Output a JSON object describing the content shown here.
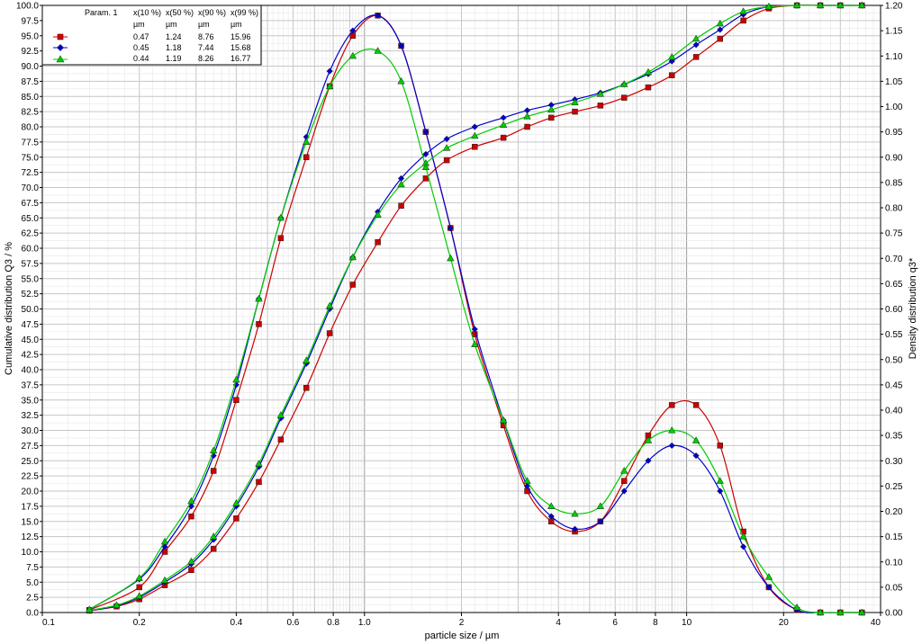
{
  "chart_data": {
    "type": "line",
    "xlabel": "particle size / µm",
    "ylabel_left": "Cumulative distribution Q3 / %",
    "ylabel_right": "Density distribution q3*",
    "x_scale": "log",
    "xlim": [
      0.1,
      40
    ],
    "ylim_left": [
      0,
      100
    ],
    "ylim_right": [
      0,
      1.2
    ],
    "x_tick_labels": [
      "0.1",
      "0.2",
      "0.4",
      "0.6",
      "0.8",
      "1.0",
      "2",
      "4",
      "6",
      "8",
      "10",
      "20",
      "40"
    ],
    "y_left_tick_labels": [
      "0.0",
      "2.5",
      "5.0",
      "7.5",
      "10.0",
      "12.5",
      "15.0",
      "17.5",
      "20.0",
      "22.5",
      "25.0",
      "27.5",
      "30.0",
      "32.5",
      "35.0",
      "37.5",
      "40.0",
      "42.5",
      "45.0",
      "47.5",
      "50.0",
      "52.5",
      "55.0",
      "57.5",
      "60.0",
      "62.5",
      "65.0",
      "67.5",
      "70.0",
      "72.5",
      "75.0",
      "77.5",
      "80.0",
      "82.5",
      "85.0",
      "87.5",
      "90.0",
      "92.5",
      "95.0",
      "97.5",
      "100.0"
    ],
    "y_right_tick_labels": [
      "0.00",
      "0.05",
      "0.10",
      "0.15",
      "0.20",
      "0.25",
      "0.30",
      "0.35",
      "0.40",
      "0.45",
      "0.50",
      "0.55",
      "0.60",
      "0.65",
      "0.70",
      "0.75",
      "0.80",
      "0.85",
      "0.90",
      "0.95",
      "1.00",
      "1.05",
      "1.10",
      "1.15",
      "1.20"
    ],
    "grid": true,
    "legend": {
      "placement": "top-left",
      "header": [
        "Param. 1",
        "x(10 %)",
        "x(50 %)",
        "x(90 %)",
        "x(99 %)"
      ],
      "units": [
        "µm",
        "µm",
        "µm",
        "µm"
      ],
      "rows": [
        {
          "values": [
            "0.47",
            "1.24",
            "8.76",
            "15.96"
          ]
        },
        {
          "values": [
            "0.45",
            "1.18",
            "7.44",
            "15.68"
          ]
        },
        {
          "values": [
            "0.44",
            "1.19",
            "8.26",
            "16.77"
          ]
        }
      ]
    },
    "series": [
      {
        "color": "#cc0000",
        "marker": "square",
        "cumulative": {
          "x": [
            0.14,
            0.17,
            0.2,
            0.24,
            0.29,
            0.34,
            0.4,
            0.47,
            0.55,
            0.66,
            0.78,
            0.92,
            1.1,
            1.3,
            1.55,
            1.8,
            2.2,
            2.7,
            3.2,
            3.8,
            4.5,
            5.4,
            6.4,
            7.6,
            9.0,
            10.7,
            12.7,
            15.0,
            18.0,
            22,
            26,
            30,
            35
          ],
          "y": [
            0.3,
            1.0,
            2.2,
            4.5,
            7.0,
            10.5,
            15.5,
            21.5,
            28.5,
            37.0,
            46.0,
            54.0,
            61.0,
            67.0,
            71.5,
            74.5,
            76.7,
            78.2,
            80.0,
            81.5,
            82.5,
            83.5,
            84.8,
            86.5,
            88.5,
            91.5,
            94.5,
            97.5,
            99.5,
            100,
            100,
            100,
            100
          ]
        },
        "density": {
          "x": [
            0.14,
            0.2,
            0.24,
            0.29,
            0.34,
            0.4,
            0.47,
            0.55,
            0.66,
            0.78,
            0.92,
            1.1,
            1.3,
            1.55,
            1.85,
            2.2,
            2.7,
            3.2,
            3.8,
            4.5,
            5.4,
            6.4,
            7.6,
            9.0,
            10.7,
            12.7,
            15.0,
            18.0,
            22,
            26,
            30,
            35
          ],
          "y": [
            0.005,
            0.05,
            0.12,
            0.19,
            0.28,
            0.42,
            0.57,
            0.74,
            0.9,
            1.04,
            1.14,
            1.18,
            1.12,
            0.95,
            0.76,
            0.55,
            0.37,
            0.24,
            0.18,
            0.16,
            0.18,
            0.26,
            0.35,
            0.41,
            0.41,
            0.33,
            0.16,
            0.05,
            0.005,
            0,
            0,
            0
          ]
        }
      },
      {
        "color": "#0000cc",
        "marker": "diamond",
        "cumulative": {
          "x": [
            0.14,
            0.17,
            0.2,
            0.24,
            0.29,
            0.34,
            0.4,
            0.47,
            0.55,
            0.66,
            0.78,
            0.92,
            1.1,
            1.3,
            1.55,
            1.8,
            2.2,
            2.7,
            3.2,
            3.8,
            4.5,
            5.4,
            6.4,
            7.6,
            9.0,
            10.7,
            12.7,
            15.0,
            18.0,
            22,
            26,
            30,
            35
          ],
          "y": [
            0.3,
            1.1,
            2.5,
            5.0,
            8.0,
            12.0,
            17.5,
            24.0,
            32.0,
            41.0,
            50.0,
            58.5,
            66.0,
            71.5,
            75.5,
            78.0,
            80.0,
            81.5,
            82.7,
            83.6,
            84.5,
            85.6,
            87.0,
            88.7,
            90.8,
            93.5,
            96.0,
            98.5,
            99.8,
            100,
            100,
            100,
            100
          ]
        },
        "density": {
          "x": [
            0.14,
            0.2,
            0.24,
            0.29,
            0.34,
            0.4,
            0.47,
            0.55,
            0.66,
            0.78,
            0.92,
            1.1,
            1.3,
            1.55,
            1.85,
            2.2,
            2.7,
            3.2,
            3.8,
            4.5,
            5.4,
            6.4,
            7.6,
            9.0,
            10.7,
            12.7,
            15.0,
            18.0,
            22,
            26,
            30,
            35
          ],
          "y": [
            0.006,
            0.066,
            0.13,
            0.21,
            0.31,
            0.45,
            0.62,
            0.78,
            0.94,
            1.07,
            1.15,
            1.18,
            1.12,
            0.95,
            0.76,
            0.56,
            0.38,
            0.25,
            0.19,
            0.165,
            0.18,
            0.24,
            0.3,
            0.33,
            0.31,
            0.24,
            0.13,
            0.05,
            0.005,
            0,
            0,
            0
          ]
        }
      },
      {
        "color": "#00cc00",
        "marker": "triangle",
        "cumulative": {
          "x": [
            0.14,
            0.17,
            0.2,
            0.24,
            0.29,
            0.34,
            0.4,
            0.47,
            0.55,
            0.66,
            0.78,
            0.92,
            1.1,
            1.3,
            1.55,
            1.8,
            2.2,
            2.7,
            3.2,
            3.8,
            4.5,
            5.4,
            6.4,
            7.6,
            9.0,
            10.7,
            12.7,
            15.0,
            18.0,
            22,
            26,
            30,
            35
          ],
          "y": [
            0.35,
            1.2,
            2.7,
            5.3,
            8.4,
            12.5,
            18.0,
            24.5,
            32.5,
            41.5,
            50.5,
            58.5,
            65.5,
            70.5,
            74.0,
            76.5,
            78.5,
            80.3,
            81.7,
            82.8,
            84.0,
            85.4,
            87.0,
            89.0,
            91.5,
            94.5,
            97.0,
            99.0,
            99.8,
            100,
            100,
            100,
            100
          ]
        },
        "density": {
          "x": [
            0.14,
            0.2,
            0.24,
            0.29,
            0.34,
            0.4,
            0.47,
            0.55,
            0.66,
            0.78,
            0.92,
            1.1,
            1.3,
            1.55,
            1.85,
            2.2,
            2.7,
            3.2,
            3.8,
            4.5,
            5.4,
            6.4,
            7.6,
            9.0,
            10.7,
            12.7,
            15.0,
            18.0,
            22,
            26,
            30,
            35
          ],
          "y": [
            0.006,
            0.068,
            0.14,
            0.22,
            0.32,
            0.46,
            0.62,
            0.78,
            0.93,
            1.04,
            1.1,
            1.11,
            1.05,
            0.88,
            0.7,
            0.53,
            0.38,
            0.26,
            0.21,
            0.195,
            0.21,
            0.28,
            0.34,
            0.36,
            0.34,
            0.26,
            0.15,
            0.07,
            0.01,
            0,
            0,
            0
          ]
        }
      }
    ]
  }
}
